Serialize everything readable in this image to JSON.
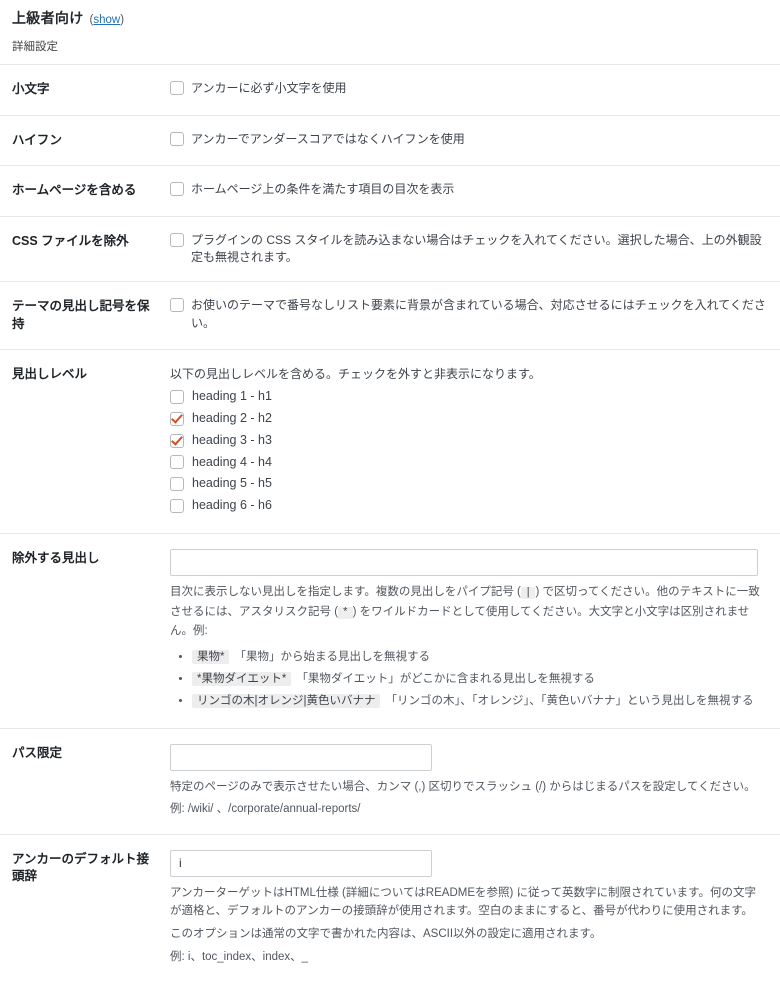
{
  "header": {
    "title": "上級者向け",
    "toggle_open": "(",
    "toggle_label": "show",
    "toggle_close": ")",
    "subtitle": "詳細設定"
  },
  "rows": {
    "lowercase": {
      "label": "小文字",
      "checkbox_text": "アンカーに必ず小文字を使用",
      "checked": false
    },
    "hyphen": {
      "label": "ハイフン",
      "checkbox_text": "アンカーでアンダースコアではなくハイフンを使用",
      "checked": false
    },
    "homepage": {
      "label": "ホームページを含める",
      "checkbox_text": "ホームページ上の条件を満たす項目の目次を表示",
      "checked": false
    },
    "exclude_css": {
      "label": "CSS ファイルを除外",
      "checkbox_text": "プラグインの CSS スタイルを読み込まない場合はチェックを入れてください。選択した場合、上の外観設定も無視されます。",
      "checked": false
    },
    "preserve_theme_bullets": {
      "label": "テーマの見出し記号を保持",
      "checkbox_text": "お使いのテーマで番号なしリスト要素に背景が含まれている場合、対応させるにはチェックを入れてください。",
      "checked": false
    },
    "heading_levels": {
      "label": "見出しレベル",
      "lead": "以下の見出しレベルを含める。チェックを外すと非表示になります。",
      "items": [
        {
          "label": "heading 1 - h1",
          "checked": false
        },
        {
          "label": "heading 2 - h2",
          "checked": true
        },
        {
          "label": "heading 3 - h3",
          "checked": true
        },
        {
          "label": "heading 4 - h4",
          "checked": false
        },
        {
          "label": "heading 5 - h5",
          "checked": false
        },
        {
          "label": "heading 6 - h6",
          "checked": false
        }
      ]
    },
    "exclude_headings": {
      "label": "除外する見出し",
      "value": "",
      "desc_1": "目次に表示しない見出しを指定します。複数の見出しをパイプ記号 (",
      "code_pipe": "|",
      "desc_2": ") で区切ってください。他のテキストに一致させるには、アスタリスク記号 (",
      "code_asterisk": "*",
      "desc_3": ") をワイルドカードとして使用してください。大文字と小文字は区別されません。例:",
      "examples": [
        {
          "code": "果物*",
          "text": "「果物」から始まる見出しを無視する"
        },
        {
          "code": "*果物ダイエット*",
          "text": "「果物ダイエット」がどこかに含まれる見出しを無視する"
        },
        {
          "code": "リンゴの木|オレンジ|黄色いバナナ",
          "text": "「リンゴの木」、「オレンジ」、「黄色いバナナ」という見出しを無視する"
        }
      ]
    },
    "path_restrict": {
      "label": "パス限定",
      "value": "",
      "desc_1": "特定のページのみで表示させたい場合、カンマ (,) 区切りでスラッシュ (/) からはじまるパスを設定してください。",
      "desc_2": "例: /wiki/ 、/corporate/annual-reports/"
    },
    "anchor_prefix": {
      "label": "アンカーのデフォルト接頭辞",
      "value": "i",
      "desc_1": "アンカーターゲットはHTML仕様 (詳細についてはREADMEを参照) に従って英数字に制限されています。何の文字が適格と、デフォルトのアンカーの接頭辞が使用されます。空白のままにすると、番号が代わりに使用されます。",
      "desc_2": "このオプションは通常の文字で書かれた内容は、ASCII以外の設定に適用されます。",
      "desc_3": "例: i、toc_index、index、_"
    }
  },
  "colors": {
    "link": "#2271b1",
    "check_orange": "#d54e21",
    "text": "#3c434a",
    "border": "#e8e8e8"
  }
}
